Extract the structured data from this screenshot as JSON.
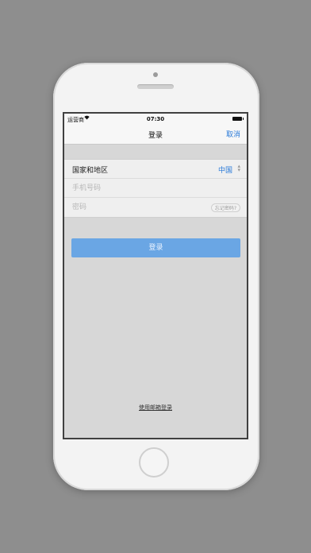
{
  "status_bar": {
    "carrier": "运营商",
    "wifi_icon": "wifi-icon",
    "time": "07:30",
    "battery_icon": "battery-icon"
  },
  "nav": {
    "title": "登录",
    "cancel_label": "取消"
  },
  "form": {
    "country_label": "国家和地区",
    "country_value": "中国",
    "country_chevron_icon": "chevron-updown-icon",
    "phone_placeholder": "手机号码",
    "password_placeholder": "密码",
    "forgot_label": "忘记密码?"
  },
  "login_button_label": "登录",
  "email_login_label": "使用邮箱登录",
  "colors": {
    "accent": "#2a7ad8",
    "login_button": "#6aa6e4"
  }
}
